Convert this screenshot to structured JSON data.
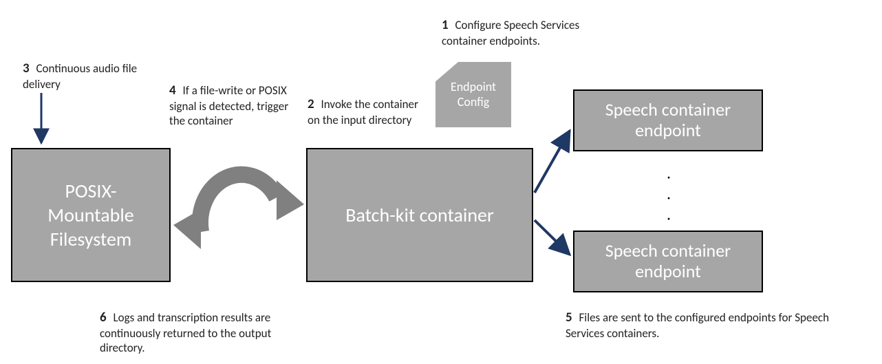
{
  "boxes": {
    "posix": "POSIX-\nMountable Filesystem",
    "batch": "Batch-kit container",
    "endpoint_top": "Speech container endpoint",
    "endpoint_bot": "Speech container endpoint",
    "config": "Endpoint Config"
  },
  "steps": {
    "s1": {
      "num": "1",
      "text": "Configure Speech Services container endpoints."
    },
    "s2": {
      "num": "2",
      "text": "Invoke the container on the input directory"
    },
    "s3": {
      "num": "3",
      "text": "Continuous audio file delivery"
    },
    "s4": {
      "num": "4",
      "text": "If a file-write or POSIX signal is detected, trigger the container"
    },
    "s5": {
      "num": "5",
      "text": "Files are sent to the configured endpoints for Speech Services containers."
    },
    "s6": {
      "num": "6",
      "text": "Logs and transcription results are continuously returned to the output directory."
    }
  },
  "dots": "·"
}
